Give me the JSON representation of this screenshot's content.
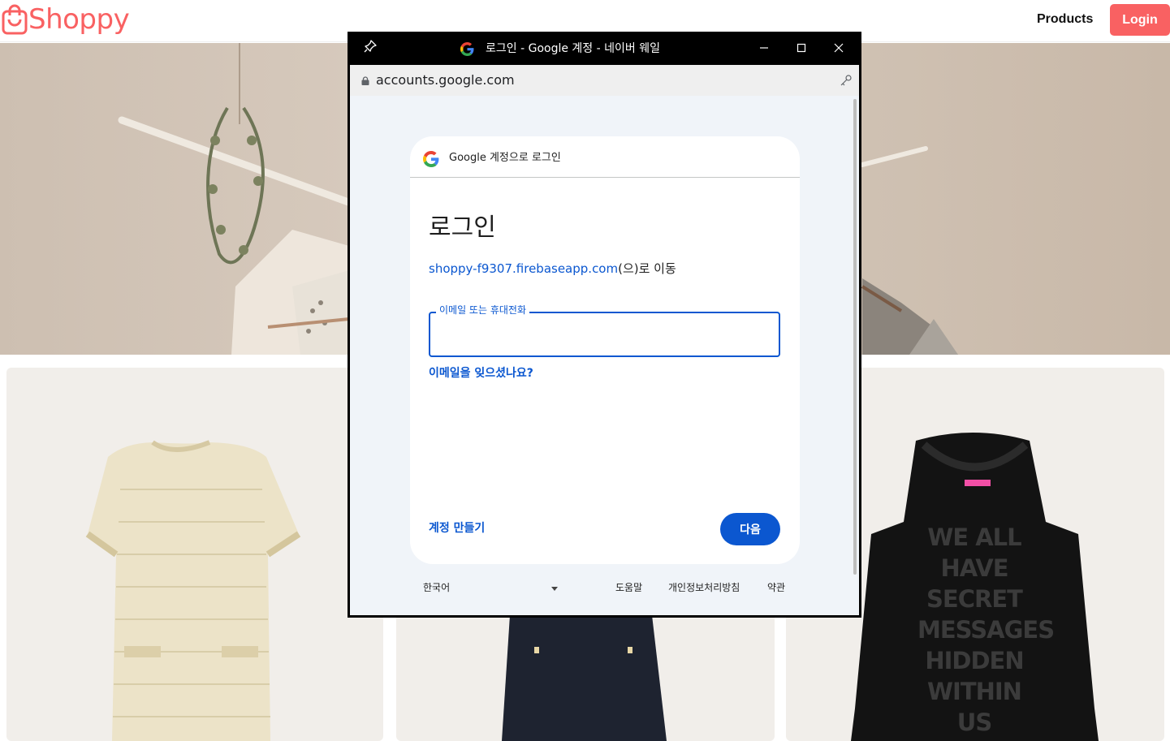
{
  "site": {
    "logo_text": "Shoppy",
    "nav_products": "Products",
    "nav_login": "Login",
    "brand_color": "#f96162"
  },
  "banner": {
    "icon": "clothes-hanger-photo"
  },
  "products": [
    {
      "icon": "tweed-dress-photo"
    },
    {
      "icon": "black-dress-photo"
    },
    {
      "icon": "black-hoodie-photo",
      "print_text": "WE ALL HAVE SECRET MESSAGES HIDDEN WITHIN US"
    }
  ],
  "popup": {
    "window_title": "로그인 - Google 계정 - 네이버 웨일",
    "url": "accounts.google.com",
    "card_header": "Google 계정으로 로그인",
    "signin_title": "로그인",
    "continue_domain": "shoppy-f9307.firebaseapp.com",
    "continue_suffix": "(으)로 이동",
    "email_label": "이메일 또는 휴대전화",
    "email_value": "",
    "forgot_email": "이메일을 잊으셨나요?",
    "create_account": "계정 만들기",
    "next_button": "다음",
    "language": "한국어",
    "footer_help": "도움말",
    "footer_privacy": "개인정보처리방침",
    "footer_terms": "약관",
    "accent_color": "#0b57d0"
  }
}
